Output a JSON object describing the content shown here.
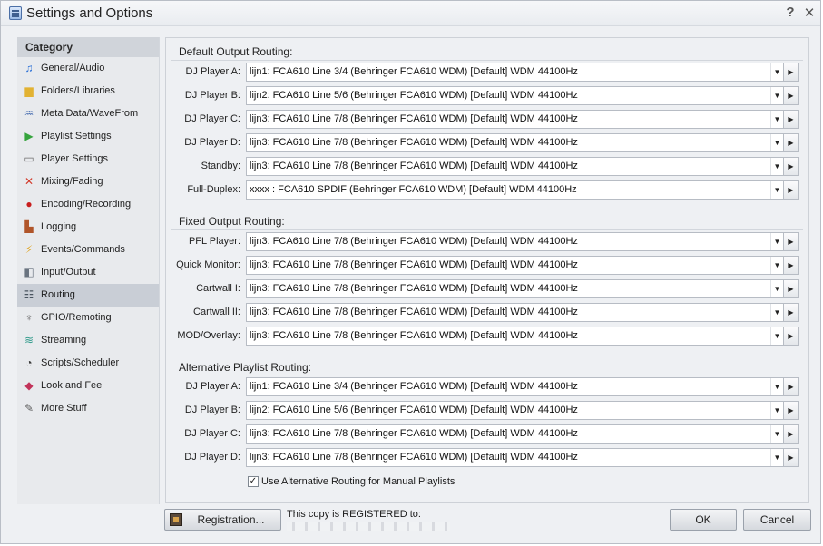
{
  "window": {
    "title": "Settings and Options",
    "help": "?",
    "close": "✕"
  },
  "sidebar": {
    "header": "Category",
    "items": [
      {
        "label": "General/Audio",
        "icon": "music-note-icon",
        "color": "#2a6fd6"
      },
      {
        "label": "Folders/Libraries",
        "icon": "folder-icon",
        "color": "#e2b232"
      },
      {
        "label": "Meta Data/WaveFrom",
        "icon": "metadata-icon",
        "color": "#4a6fb1"
      },
      {
        "label": "Playlist Settings",
        "icon": "playlist-icon",
        "color": "#35a43d"
      },
      {
        "label": "Player Settings",
        "icon": "player-icon",
        "color": "#6b6b6b"
      },
      {
        "label": "Mixing/Fading",
        "icon": "mixing-icon",
        "color": "#d23a2a"
      },
      {
        "label": "Encoding/Recording",
        "icon": "record-icon",
        "color": "#c81e1e"
      },
      {
        "label": "Logging",
        "icon": "logging-icon",
        "color": "#b0552a"
      },
      {
        "label": "Events/Commands",
        "icon": "lightning-icon",
        "color": "#e0a21c"
      },
      {
        "label": "Input/Output",
        "icon": "io-icon",
        "color": "#6a7480"
      },
      {
        "label": "Routing",
        "icon": "routing-icon",
        "color": "#4a5560",
        "selected": true
      },
      {
        "label": "GPIO/Remoting",
        "icon": "gpio-icon",
        "color": "#6b6b6b"
      },
      {
        "label": "Streaming",
        "icon": "streaming-icon",
        "color": "#2f9a8a"
      },
      {
        "label": "Scripts/Scheduler",
        "icon": "clock-icon",
        "color": "#3b3b3b"
      },
      {
        "label": "Look and Feel",
        "icon": "palette-icon",
        "color": "#c2335a"
      },
      {
        "label": "More Stuff",
        "icon": "more-stuff-icon",
        "color": "#5a5a5a"
      }
    ]
  },
  "routing": {
    "default_title": "Default Output Routing:",
    "default_rows": [
      {
        "label": "DJ Player A:",
        "value": "lijn1: FCA610 Line 3/4 (Behringer FCA610 WDM) [Default] WDM 44100Hz"
      },
      {
        "label": "DJ Player B:",
        "value": "lijn2: FCA610 Line 5/6 (Behringer FCA610 WDM) [Default] WDM 44100Hz"
      },
      {
        "label": "DJ Player C:",
        "value": "lijn3: FCA610 Line 7/8 (Behringer FCA610 WDM) [Default] WDM 44100Hz"
      },
      {
        "label": "DJ Player D:",
        "value": "lijn3: FCA610 Line 7/8 (Behringer FCA610 WDM) [Default] WDM 44100Hz"
      },
      {
        "label": "Standby:",
        "value": "lijn3: FCA610 Line 7/8 (Behringer FCA610 WDM) [Default] WDM 44100Hz"
      },
      {
        "label": "Full-Duplex:",
        "value": "xxxx : FCA610 SPDIF (Behringer FCA610 WDM) [Default] WDM 44100Hz"
      }
    ],
    "fixed_title": "Fixed Output Routing:",
    "fixed_rows": [
      {
        "label": "PFL Player:",
        "value": "lijn3: FCA610 Line 7/8 (Behringer FCA610 WDM) [Default] WDM 44100Hz"
      },
      {
        "label": "Quick Monitor:",
        "value": "lijn3: FCA610 Line 7/8 (Behringer FCA610 WDM) [Default] WDM 44100Hz"
      },
      {
        "label": "Cartwall I:",
        "value": "lijn3: FCA610 Line 7/8 (Behringer FCA610 WDM) [Default] WDM 44100Hz"
      },
      {
        "label": "Cartwall II:",
        "value": "lijn3: FCA610 Line 7/8 (Behringer FCA610 WDM) [Default] WDM 44100Hz"
      },
      {
        "label": "MOD/Overlay:",
        "value": "lijn3: FCA610 Line 7/8 (Behringer FCA610 WDM) [Default] WDM 44100Hz"
      }
    ],
    "alt_title": "Alternative Playlist Routing:",
    "alt_rows": [
      {
        "label": "DJ Player A:",
        "value": "lijn1: FCA610 Line 3/4 (Behringer FCA610 WDM) [Default] WDM 44100Hz"
      },
      {
        "label": "DJ Player B:",
        "value": "lijn2: FCA610 Line 5/6 (Behringer FCA610 WDM) [Default] WDM 44100Hz"
      },
      {
        "label": "DJ Player C:",
        "value": "lijn3: FCA610 Line 7/8 (Behringer FCA610 WDM) [Default] WDM 44100Hz"
      },
      {
        "label": "DJ Player D:",
        "value": "lijn3: FCA610 Line 7/8 (Behringer FCA610 WDM) [Default] WDM 44100Hz"
      }
    ],
    "alt_checkbox_label": "Use Alternative Routing for Manual Playlists",
    "alt_checkbox_checked": true,
    "dropdown_glyph": "▼",
    "play_glyph": "▶"
  },
  "footer": {
    "registration_label": "Registration...",
    "registered_text": "This copy is REGISTERED to:",
    "ok_label": "OK",
    "cancel_label": "Cancel"
  }
}
